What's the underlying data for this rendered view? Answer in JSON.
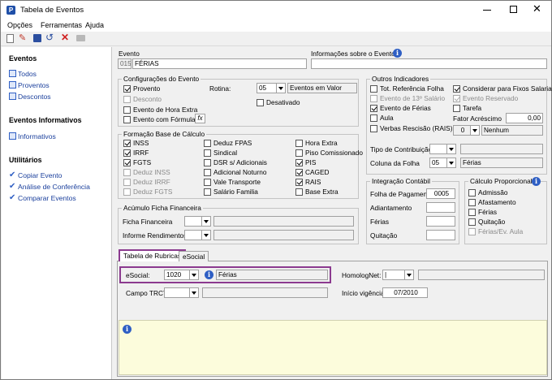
{
  "window": {
    "title": "Tabela de Eventos"
  },
  "menu": {
    "opcoes": "Opções",
    "ferramentas": "Ferramentas",
    "ajuda": "Ajuda"
  },
  "sidebar": {
    "eventos_header": "Eventos",
    "eventos": [
      "Todos",
      "Proventos",
      "Descontos"
    ],
    "informativos_header": "Eventos Informativos",
    "informativos": [
      "Informativos"
    ],
    "utilitarios_header": "Utilitários",
    "utilitarios": [
      "Copiar Evento",
      "Análise de Conferência",
      "Comparar Eventos"
    ]
  },
  "evento": {
    "label": "Evento",
    "code": "015",
    "name": "FÉRIAS",
    "info_label": "Informações sobre o Evento",
    "info_value": ""
  },
  "config": {
    "title": "Configurações do Evento",
    "provento": "Provento",
    "desconto": "Desconto",
    "hora_extra": "Evento de Hora Extra",
    "formula": "Evento com Fórmula",
    "fx": "fx",
    "rotina_label": "Rotina:",
    "rotina_value": "05",
    "rotina_desc": "Eventos em Valor",
    "desativado": "Desativado"
  },
  "base": {
    "title": "Formação Base de Cálculo",
    "col1": [
      "INSS",
      "IRRF",
      "FGTS",
      "Deduz INSS",
      "Deduz IRRF",
      "Deduz FGTS"
    ],
    "col2": [
      "Deduz FPAS",
      "Sindical",
      "DSR s/ Adicionais",
      "Adicional Noturno",
      "Vale Transporte",
      "Salário Familia"
    ],
    "col3": [
      "Hora Extra",
      "Piso Comissionado",
      "PIS",
      "CAGED",
      "RAIS",
      "Base Extra"
    ]
  },
  "acumulo": {
    "title": "Acúmulo Ficha Financeira",
    "ficha": "Ficha Financeira",
    "informe": "Informe Rendimentos"
  },
  "outros": {
    "title": "Outros Indicadores",
    "tot_ref": "Tot. Referência Folha",
    "evento13": "Evento de 13º Salário",
    "evento_ferias": "Evento de Férias",
    "aula": "Aula",
    "verbas": "Verbas Rescisão (RAIS)",
    "considerar": "Considerar para Fixos Salariais",
    "reservado": "Evento Reservado",
    "tarefa": "Tarefa",
    "fator_label": "Fator Acréscimo",
    "fator_value": "0,00",
    "nenhum_value": "0",
    "nenhum_desc": "Nenhum",
    "tipo_contrib": "Tipo de Contribuição",
    "coluna_folha": "Coluna da Folha",
    "coluna_value": "05",
    "coluna_desc": "Férias"
  },
  "integracao": {
    "title": "Integração Contábil",
    "folha": "Folha de Pagamento",
    "folha_value": "0005",
    "adiantamento": "Adiantamento",
    "ferias": "Férias",
    "quitacao": "Quitação"
  },
  "calculo": {
    "title": "Cálculo Proporcional",
    "items": [
      "Admissão",
      "Afastamento",
      "Férias",
      "Quitação",
      "Férias/Ev. Aula"
    ]
  },
  "tabs": {
    "rubricas": "Tabela de Rubricas",
    "esocial": "eSocial"
  },
  "rubricas": {
    "esocial_label": "eSocial:",
    "esocial_code": "1020",
    "esocial_desc": "Férias",
    "homolognet_label": "HomologNet:",
    "homolognet_value": "|",
    "trct_label": "Campo TRCT:",
    "inicio_label": "Início vigência:",
    "inicio_value": "07/2010"
  }
}
